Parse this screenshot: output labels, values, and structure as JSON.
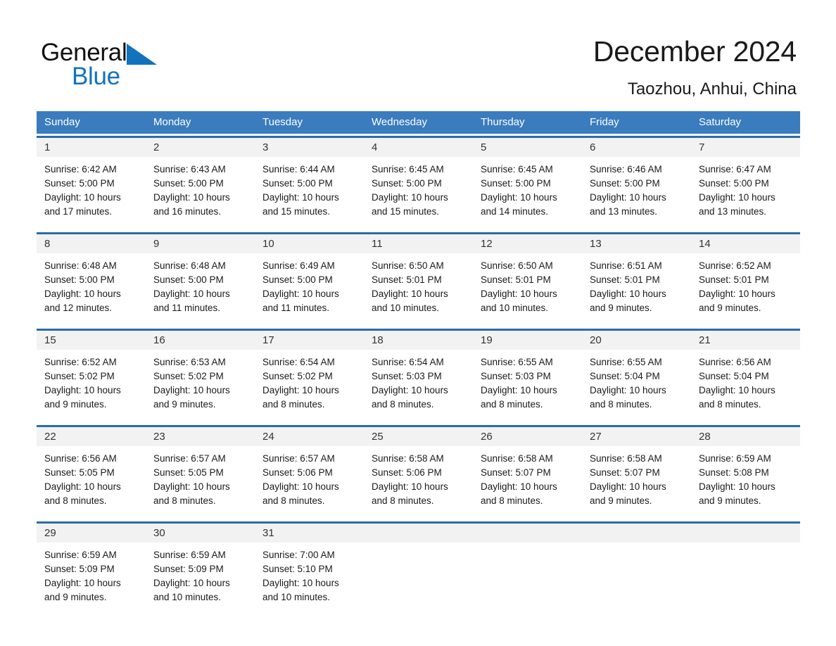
{
  "brand": {
    "name_part1": "General",
    "name_part2": "Blue",
    "triangle_color": "#1273bd"
  },
  "header": {
    "title": "December 2024",
    "subtitle": "Taozhou, Anhui, China"
  },
  "theme": {
    "header_bar": "#3a7cbe",
    "row_rule": "#2b6ca8",
    "daynum_band": "#f2f2f2",
    "text": "#1a1a1a"
  },
  "weekdays": [
    "Sunday",
    "Monday",
    "Tuesday",
    "Wednesday",
    "Thursday",
    "Friday",
    "Saturday"
  ],
  "labels": {
    "sunrise_prefix": "Sunrise:",
    "sunset_prefix": "Sunset:",
    "daylight_prefix": "Daylight:"
  },
  "weeks": [
    [
      {
        "day": "1",
        "sunrise": "Sunrise: 6:42 AM",
        "sunset": "Sunset: 5:00 PM",
        "daylight_1": "Daylight: 10 hours",
        "daylight_2": "and 17 minutes."
      },
      {
        "day": "2",
        "sunrise": "Sunrise: 6:43 AM",
        "sunset": "Sunset: 5:00 PM",
        "daylight_1": "Daylight: 10 hours",
        "daylight_2": "and 16 minutes."
      },
      {
        "day": "3",
        "sunrise": "Sunrise: 6:44 AM",
        "sunset": "Sunset: 5:00 PM",
        "daylight_1": "Daylight: 10 hours",
        "daylight_2": "and 15 minutes."
      },
      {
        "day": "4",
        "sunrise": "Sunrise: 6:45 AM",
        "sunset": "Sunset: 5:00 PM",
        "daylight_1": "Daylight: 10 hours",
        "daylight_2": "and 15 minutes."
      },
      {
        "day": "5",
        "sunrise": "Sunrise: 6:45 AM",
        "sunset": "Sunset: 5:00 PM",
        "daylight_1": "Daylight: 10 hours",
        "daylight_2": "and 14 minutes."
      },
      {
        "day": "6",
        "sunrise": "Sunrise: 6:46 AM",
        "sunset": "Sunset: 5:00 PM",
        "daylight_1": "Daylight: 10 hours",
        "daylight_2": "and 13 minutes."
      },
      {
        "day": "7",
        "sunrise": "Sunrise: 6:47 AM",
        "sunset": "Sunset: 5:00 PM",
        "daylight_1": "Daylight: 10 hours",
        "daylight_2": "and 13 minutes."
      }
    ],
    [
      {
        "day": "8",
        "sunrise": "Sunrise: 6:48 AM",
        "sunset": "Sunset: 5:00 PM",
        "daylight_1": "Daylight: 10 hours",
        "daylight_2": "and 12 minutes."
      },
      {
        "day": "9",
        "sunrise": "Sunrise: 6:48 AM",
        "sunset": "Sunset: 5:00 PM",
        "daylight_1": "Daylight: 10 hours",
        "daylight_2": "and 11 minutes."
      },
      {
        "day": "10",
        "sunrise": "Sunrise: 6:49 AM",
        "sunset": "Sunset: 5:00 PM",
        "daylight_1": "Daylight: 10 hours",
        "daylight_2": "and 11 minutes."
      },
      {
        "day": "11",
        "sunrise": "Sunrise: 6:50 AM",
        "sunset": "Sunset: 5:01 PM",
        "daylight_1": "Daylight: 10 hours",
        "daylight_2": "and 10 minutes."
      },
      {
        "day": "12",
        "sunrise": "Sunrise: 6:50 AM",
        "sunset": "Sunset: 5:01 PM",
        "daylight_1": "Daylight: 10 hours",
        "daylight_2": "and 10 minutes."
      },
      {
        "day": "13",
        "sunrise": "Sunrise: 6:51 AM",
        "sunset": "Sunset: 5:01 PM",
        "daylight_1": "Daylight: 10 hours",
        "daylight_2": "and 9 minutes."
      },
      {
        "day": "14",
        "sunrise": "Sunrise: 6:52 AM",
        "sunset": "Sunset: 5:01 PM",
        "daylight_1": "Daylight: 10 hours",
        "daylight_2": "and 9 minutes."
      }
    ],
    [
      {
        "day": "15",
        "sunrise": "Sunrise: 6:52 AM",
        "sunset": "Sunset: 5:02 PM",
        "daylight_1": "Daylight: 10 hours",
        "daylight_2": "and 9 minutes."
      },
      {
        "day": "16",
        "sunrise": "Sunrise: 6:53 AM",
        "sunset": "Sunset: 5:02 PM",
        "daylight_1": "Daylight: 10 hours",
        "daylight_2": "and 9 minutes."
      },
      {
        "day": "17",
        "sunrise": "Sunrise: 6:54 AM",
        "sunset": "Sunset: 5:02 PM",
        "daylight_1": "Daylight: 10 hours",
        "daylight_2": "and 8 minutes."
      },
      {
        "day": "18",
        "sunrise": "Sunrise: 6:54 AM",
        "sunset": "Sunset: 5:03 PM",
        "daylight_1": "Daylight: 10 hours",
        "daylight_2": "and 8 minutes."
      },
      {
        "day": "19",
        "sunrise": "Sunrise: 6:55 AM",
        "sunset": "Sunset: 5:03 PM",
        "daylight_1": "Daylight: 10 hours",
        "daylight_2": "and 8 minutes."
      },
      {
        "day": "20",
        "sunrise": "Sunrise: 6:55 AM",
        "sunset": "Sunset: 5:04 PM",
        "daylight_1": "Daylight: 10 hours",
        "daylight_2": "and 8 minutes."
      },
      {
        "day": "21",
        "sunrise": "Sunrise: 6:56 AM",
        "sunset": "Sunset: 5:04 PM",
        "daylight_1": "Daylight: 10 hours",
        "daylight_2": "and 8 minutes."
      }
    ],
    [
      {
        "day": "22",
        "sunrise": "Sunrise: 6:56 AM",
        "sunset": "Sunset: 5:05 PM",
        "daylight_1": "Daylight: 10 hours",
        "daylight_2": "and 8 minutes."
      },
      {
        "day": "23",
        "sunrise": "Sunrise: 6:57 AM",
        "sunset": "Sunset: 5:05 PM",
        "daylight_1": "Daylight: 10 hours",
        "daylight_2": "and 8 minutes."
      },
      {
        "day": "24",
        "sunrise": "Sunrise: 6:57 AM",
        "sunset": "Sunset: 5:06 PM",
        "daylight_1": "Daylight: 10 hours",
        "daylight_2": "and 8 minutes."
      },
      {
        "day": "25",
        "sunrise": "Sunrise: 6:58 AM",
        "sunset": "Sunset: 5:06 PM",
        "daylight_1": "Daylight: 10 hours",
        "daylight_2": "and 8 minutes."
      },
      {
        "day": "26",
        "sunrise": "Sunrise: 6:58 AM",
        "sunset": "Sunset: 5:07 PM",
        "daylight_1": "Daylight: 10 hours",
        "daylight_2": "and 8 minutes."
      },
      {
        "day": "27",
        "sunrise": "Sunrise: 6:58 AM",
        "sunset": "Sunset: 5:07 PM",
        "daylight_1": "Daylight: 10 hours",
        "daylight_2": "and 9 minutes."
      },
      {
        "day": "28",
        "sunrise": "Sunrise: 6:59 AM",
        "sunset": "Sunset: 5:08 PM",
        "daylight_1": "Daylight: 10 hours",
        "daylight_2": "and 9 minutes."
      }
    ],
    [
      {
        "day": "29",
        "sunrise": "Sunrise: 6:59 AM",
        "sunset": "Sunset: 5:09 PM",
        "daylight_1": "Daylight: 10 hours",
        "daylight_2": "and 9 minutes."
      },
      {
        "day": "30",
        "sunrise": "Sunrise: 6:59 AM",
        "sunset": "Sunset: 5:09 PM",
        "daylight_1": "Daylight: 10 hours",
        "daylight_2": "and 10 minutes."
      },
      {
        "day": "31",
        "sunrise": "Sunrise: 7:00 AM",
        "sunset": "Sunset: 5:10 PM",
        "daylight_1": "Daylight: 10 hours",
        "daylight_2": "and 10 minutes."
      },
      {
        "day": "",
        "sunrise": "",
        "sunset": "",
        "daylight_1": "",
        "daylight_2": ""
      },
      {
        "day": "",
        "sunrise": "",
        "sunset": "",
        "daylight_1": "",
        "daylight_2": ""
      },
      {
        "day": "",
        "sunrise": "",
        "sunset": "",
        "daylight_1": "",
        "daylight_2": ""
      },
      {
        "day": "",
        "sunrise": "",
        "sunset": "",
        "daylight_1": "",
        "daylight_2": ""
      }
    ]
  ]
}
